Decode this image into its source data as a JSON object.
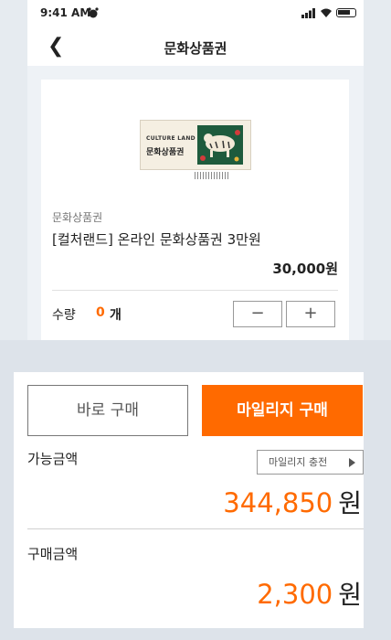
{
  "status": {
    "time": "9:41 AM"
  },
  "nav": {
    "title": "문화상품권"
  },
  "product": {
    "image_brand": "CULTURE LAND",
    "image_name": "문화상품권",
    "category": "문화상품권",
    "name": "[컬처랜드] 온라인 문화상품권 3만원",
    "price": "30,000원"
  },
  "quantity": {
    "label": "수량",
    "value": "0",
    "unit": "개",
    "minus": "−",
    "plus": "+"
  },
  "actions": {
    "buy_now": "바로 구매",
    "mileage_buy": "마일리지 구매"
  },
  "balance": {
    "label": "가능금액",
    "charge_button": "마일리지 충전",
    "amount": "344,850",
    "unit": "원"
  },
  "payment": {
    "label": "구매금액",
    "amount": "2,300",
    "unit": "원"
  },
  "colors": {
    "accent": "#ff6a00"
  }
}
